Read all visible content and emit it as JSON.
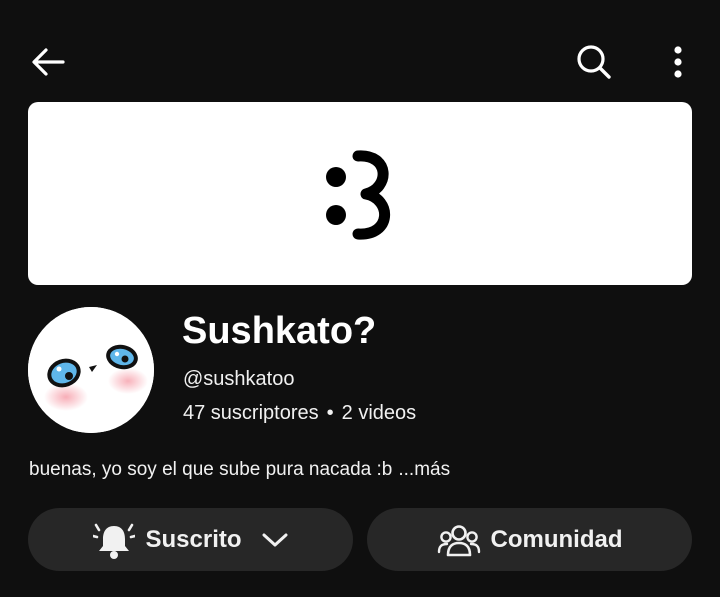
{
  "header": {
    "back_icon": "arrow-left-icon",
    "search_icon": "search-icon",
    "more_icon": "more-vertical-icon"
  },
  "banner": {
    "face_text": ":3"
  },
  "channel": {
    "name": "Sushkato?",
    "handle": "@sushkatoo",
    "subscribers": "47 suscriptores",
    "separator": "•",
    "videos": "2 videos",
    "description": "buenas, yo soy el que sube pura nacada :b",
    "more_label": "...más"
  },
  "actions": {
    "subscribe_label": "Suscrito",
    "subscribe_icon": "bell-ringing-icon",
    "dropdown_icon": "chevron-down-icon",
    "community_label": "Comunidad",
    "community_icon": "people-icon"
  },
  "colors": {
    "background": "#0f0f0f",
    "pill_background": "#272727",
    "text": "#f1f1f1",
    "banner_background": "#ffffff"
  }
}
